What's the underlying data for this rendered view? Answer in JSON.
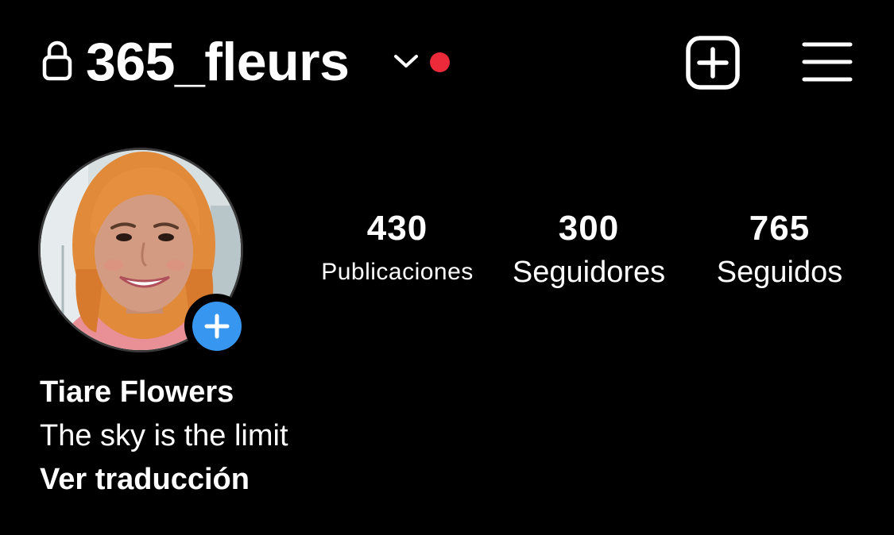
{
  "header": {
    "username": "365_fleurs",
    "lock_icon": "lock-icon",
    "switch_account_icon": "chevron-down-icon",
    "notification_dot_color": "#ed2a3a",
    "new_post_icon": "plus-square-icon",
    "menu_icon": "hamburger-menu-icon"
  },
  "profile": {
    "avatar_icon": "profile-photo",
    "add_story_icon": "plus-icon",
    "add_story_color": "#3797f0",
    "display_name": "Tiare Flowers",
    "bio": "The sky is the limit",
    "translate_label": "Ver traducción"
  },
  "stats": {
    "posts": {
      "value": "430",
      "label": "Publicaciones"
    },
    "followers": {
      "value": "300",
      "label": "Seguidores"
    },
    "following": {
      "value": "765",
      "label": "Seguidos"
    }
  }
}
